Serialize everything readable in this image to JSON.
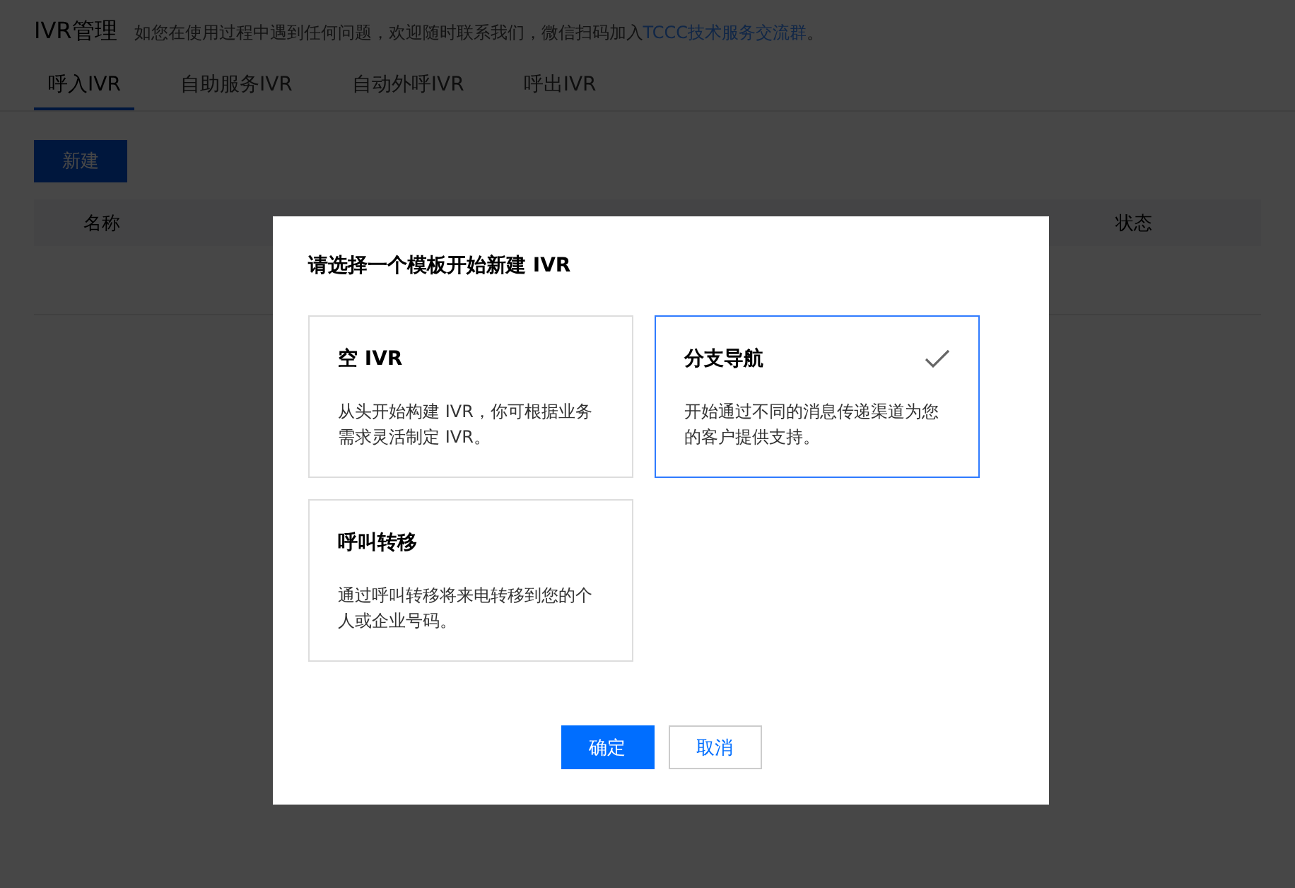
{
  "header": {
    "title": "IVR管理",
    "notice": "如您在使用过程中遇到任何问题，欢迎随时联系我们，微信扫码加入",
    "notice_link": "TCCC技术服务交流群",
    "notice_end": "。"
  },
  "tabs": [
    {
      "label": "呼入IVR",
      "selected": true
    },
    {
      "label": "自助服务IVR",
      "selected": false
    },
    {
      "label": "自动外呼IVR",
      "selected": false
    },
    {
      "label": "呼出IVR",
      "selected": false
    }
  ],
  "new_button": "新建",
  "table": {
    "columns": [
      {
        "label": "名称"
      },
      {
        "label": "状态"
      }
    ]
  },
  "dialog": {
    "title": "请选择一个模板开始新建 IVR",
    "templates": [
      {
        "title": "空 IVR",
        "description": "从头开始构建 IVR，你可根据业务需求灵活制定 IVR。",
        "selected": false
      },
      {
        "title": "分支导航",
        "description": "开始通过不同的消息传递渠道为您的客户提供支持。",
        "selected": true
      },
      {
        "title": "呼叫转移",
        "description": "通过呼叫转移将来电转移到您的个人或企业号码。",
        "selected": false
      }
    ],
    "buttons": [
      {
        "label": "确定",
        "kind": "primary"
      },
      {
        "label": "取消",
        "kind": "secondary"
      }
    ]
  }
}
